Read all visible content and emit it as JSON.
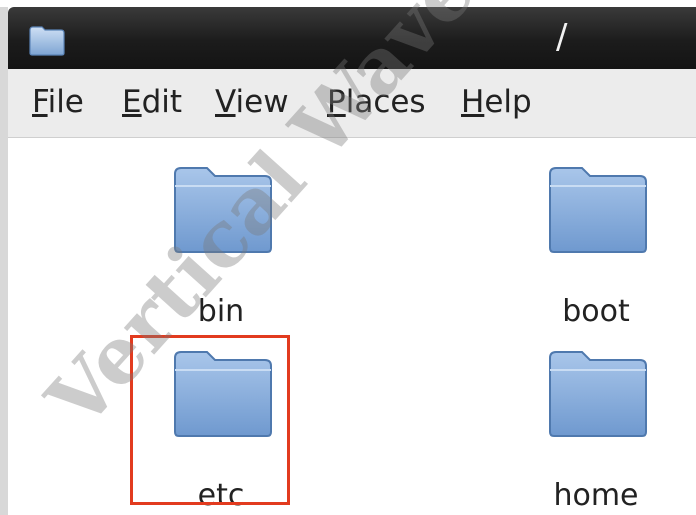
{
  "window": {
    "title": "/"
  },
  "menubar": {
    "items": [
      {
        "mnemonic": "F",
        "rest": "ile"
      },
      {
        "mnemonic": "E",
        "rest": "dit"
      },
      {
        "mnemonic": "V",
        "rest": "iew"
      },
      {
        "mnemonic": "P",
        "rest": "laces"
      },
      {
        "mnemonic": "H",
        "rest": "elp"
      }
    ]
  },
  "files": [
    {
      "name": "bin",
      "icon": "folder-icon"
    },
    {
      "name": "boot",
      "icon": "folder-icon"
    },
    {
      "name": "etc",
      "icon": "folder-icon",
      "highlighted": true
    },
    {
      "name": "home",
      "icon": "folder-icon"
    }
  ],
  "watermark": {
    "text": "Vertical Wave L"
  },
  "colors": {
    "titlebar": "#1c1c1c",
    "menubar": "#ececec",
    "folder": "#7fa7d6",
    "highlight_border": "#e23b1f"
  }
}
